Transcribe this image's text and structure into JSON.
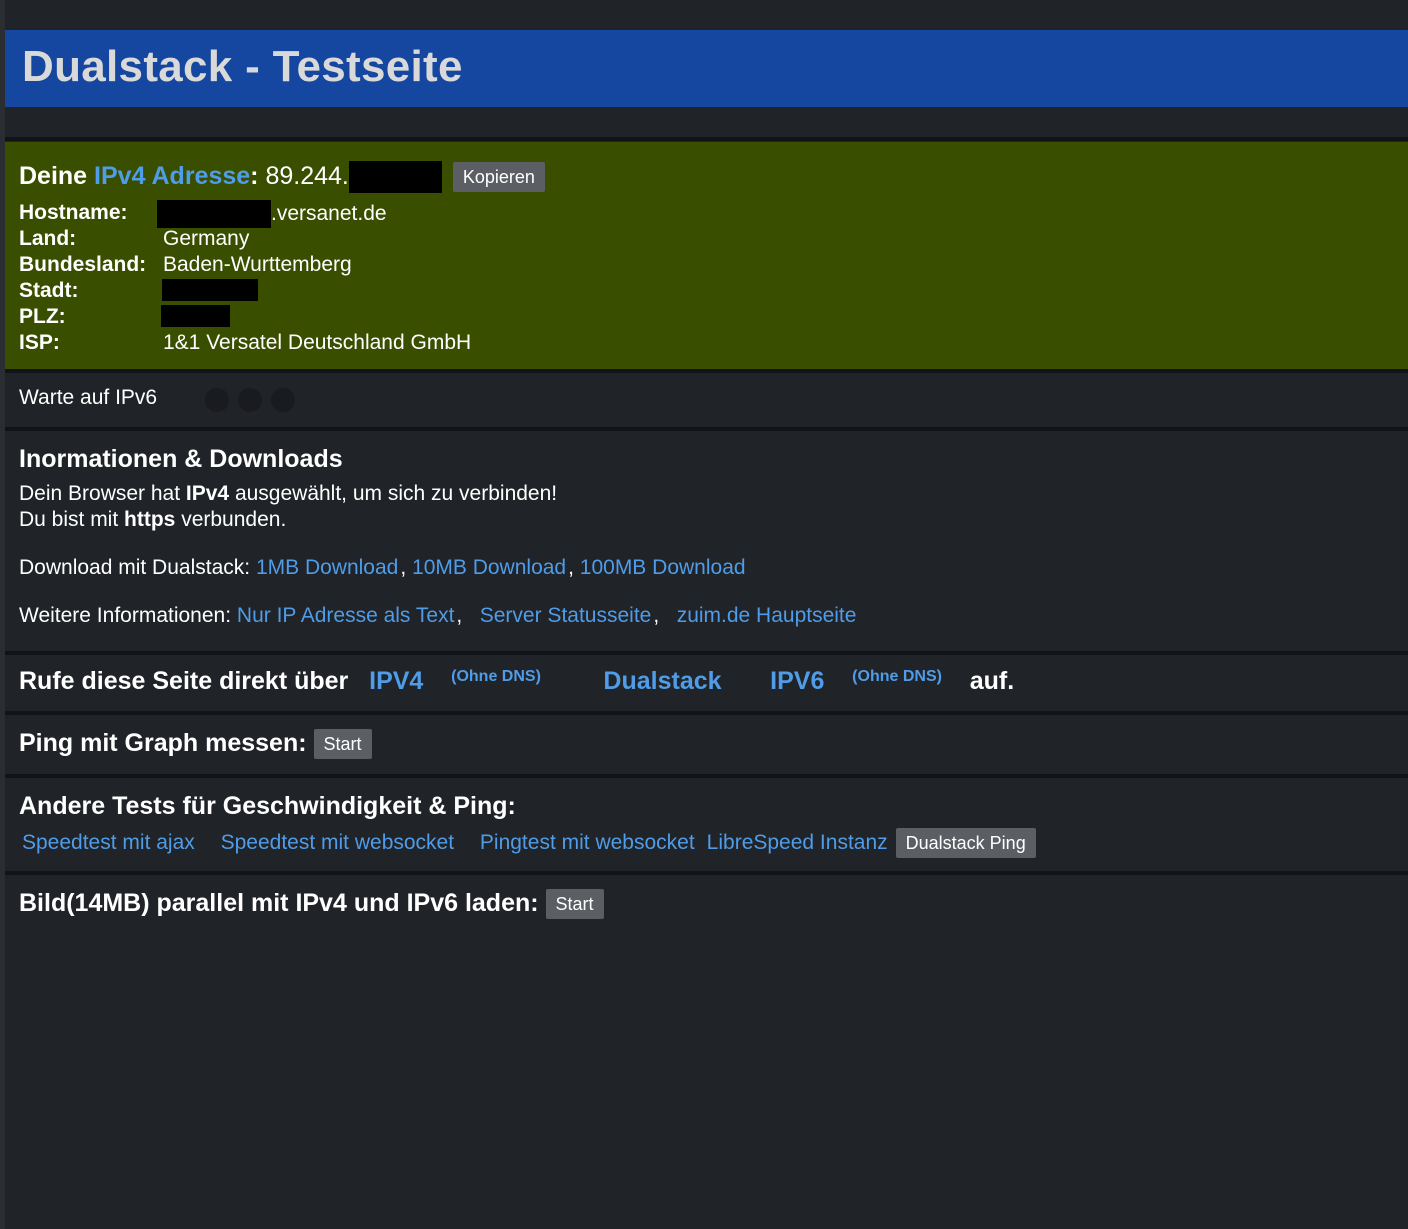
{
  "header": {
    "title": "Dualstack - Testseite"
  },
  "ipv4": {
    "prefix": "Deine",
    "link_label": "IPv4 Adresse",
    "colon": ":",
    "ip_visible": "89.244.",
    "copy_button": "Kopieren",
    "rows": [
      {
        "key": "Hostname:",
        "value_suffix": ".versanet.de"
      },
      {
        "key": "Land:",
        "value": "Germany"
      },
      {
        "key": "Bundesland:",
        "value": "Baden-Wurttemberg"
      },
      {
        "key": "Stadt:",
        "value": ""
      },
      {
        "key": "PLZ:",
        "value": ""
      },
      {
        "key": "ISP:",
        "value": "1&1 Versatel Deutschland GmbH"
      }
    ]
  },
  "ipv6": {
    "waiting": "Warte auf IPv6"
  },
  "info": {
    "title": "Inormationen & Downloads",
    "browser_pre": "Dein Browser hat ",
    "browser_proto": "IPv4",
    "browser_post": " ausgewählt, um sich zu verbinden!",
    "conn_pre": "Du bist mit ",
    "conn_proto": "https",
    "conn_post": " verbunden.",
    "download_label": "Download mit Dualstack:",
    "downloads": [
      "1MB Download",
      "10MB Download",
      "100MB Download"
    ],
    "more_label": "Weitere Informationen:",
    "more_links": [
      "Nur IP Adresse als Text",
      "Server Statusseite",
      "zuim.de Hauptseite"
    ]
  },
  "direct": {
    "pre": "Rufe diese Seite direkt über",
    "ipv4": "IPV4",
    "ipv4_note": "(Ohne DNS)",
    "dualstack": "Dualstack",
    "ipv6": "IPV6",
    "ipv6_note": "(Ohne DNS)",
    "post": "auf."
  },
  "ping_graph": {
    "title": "Ping mit Graph messen:",
    "button": "Start"
  },
  "other_tests": {
    "title": "Andere Tests für Geschwindigkeit & Ping:",
    "links": [
      "Speedtest mit ajax",
      "Speedtest mit websocket",
      "Pingtest mit websocket",
      "LibreSpeed Instanz"
    ],
    "button": "Dualstack Ping"
  },
  "image_test": {
    "title": "Bild(14MB) parallel mit IPv4 und IPv6 laden:",
    "button": "Start"
  },
  "colors": {
    "header_bg": "#1647a0",
    "ipv4_bg": "#3a4e00",
    "page_bg": "#202327",
    "link": "#4f9ce8"
  }
}
